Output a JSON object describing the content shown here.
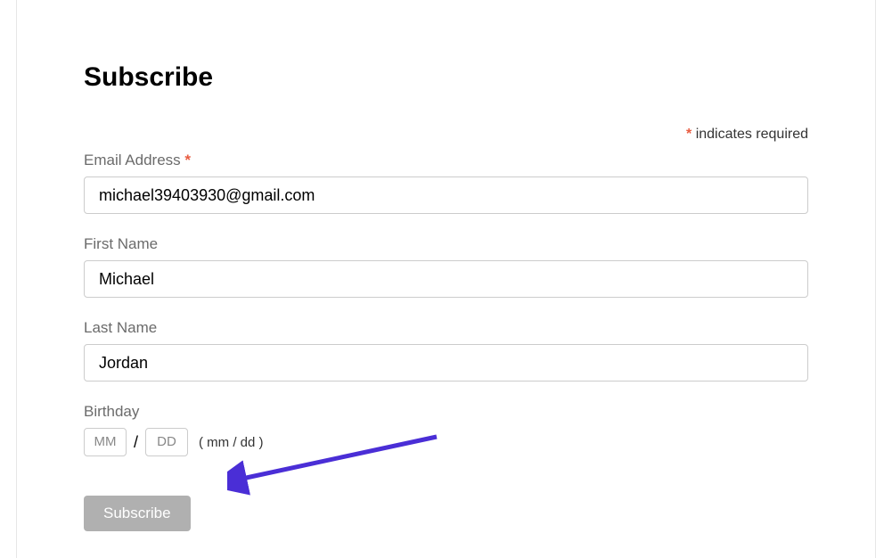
{
  "heading": "Subscribe",
  "required_note_text": "indicates required",
  "asterisk": "*",
  "form": {
    "email": {
      "label": "Email Address",
      "value": "michael39403930@gmail.com",
      "required_mark": "*"
    },
    "first_name": {
      "label": "First Name",
      "value": "Michael"
    },
    "last_name": {
      "label": "Last Name",
      "value": "Jordan"
    },
    "birthday": {
      "label": "Birthday",
      "mm_placeholder": "MM",
      "dd_placeholder": "DD",
      "separator": "/",
      "hint": "( mm / dd )"
    },
    "submit_label": "Subscribe"
  },
  "annotation": {
    "arrow_color": "#4a2ed6"
  }
}
